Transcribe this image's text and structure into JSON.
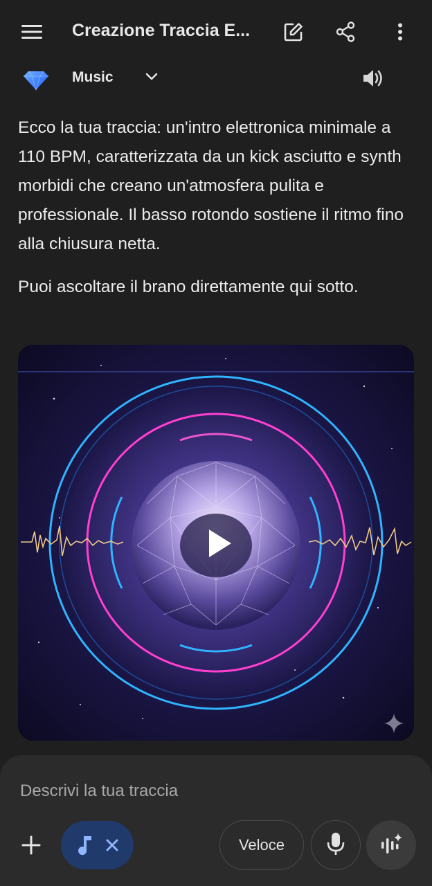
{
  "header": {
    "title": "Creazione Traccia E...",
    "menu_icon": "hamburger-menu-icon",
    "edit_icon": "edit-icon",
    "share_icon": "share-icon",
    "more_icon": "more-vert-icon"
  },
  "model_bar": {
    "label": "Music",
    "logo_icon": "gemini-diamond-icon",
    "dropdown_icon": "chevron-down-icon",
    "speaker_icon": "speaker-icon"
  },
  "response": {
    "paragraph1": "Ecco la tua traccia: un'intro elettronica minimale a 110 BPM, caratterizzata da un kick asciutto e synth morbidi che creano un'atmosfera pulita e professionale. Il basso rotondo sostiene il ritmo fino alla chiusura netta.",
    "paragraph2": "Puoi ascoltare il brano direttamente qui sotto."
  },
  "media": {
    "play_icon": "play-icon",
    "sparkle_icon": "sparkle-icon"
  },
  "composer": {
    "placeholder": "Descrivi la tua traccia",
    "add_icon": "plus-icon",
    "music_chip_icon": "music-note-icon",
    "music_chip_close_icon": "close-icon",
    "speed_label": "Veloce",
    "mic_icon": "mic-icon",
    "live_icon": "live-sparkle-icon"
  },
  "colors": {
    "background": "#1f1f1f",
    "composer": "#2b2b2b",
    "chip": "#1f3a6b",
    "accent_blue": "#4a8cff",
    "ring_pink": "#ff3fd0",
    "ring_cyan": "#2fb4ff"
  }
}
